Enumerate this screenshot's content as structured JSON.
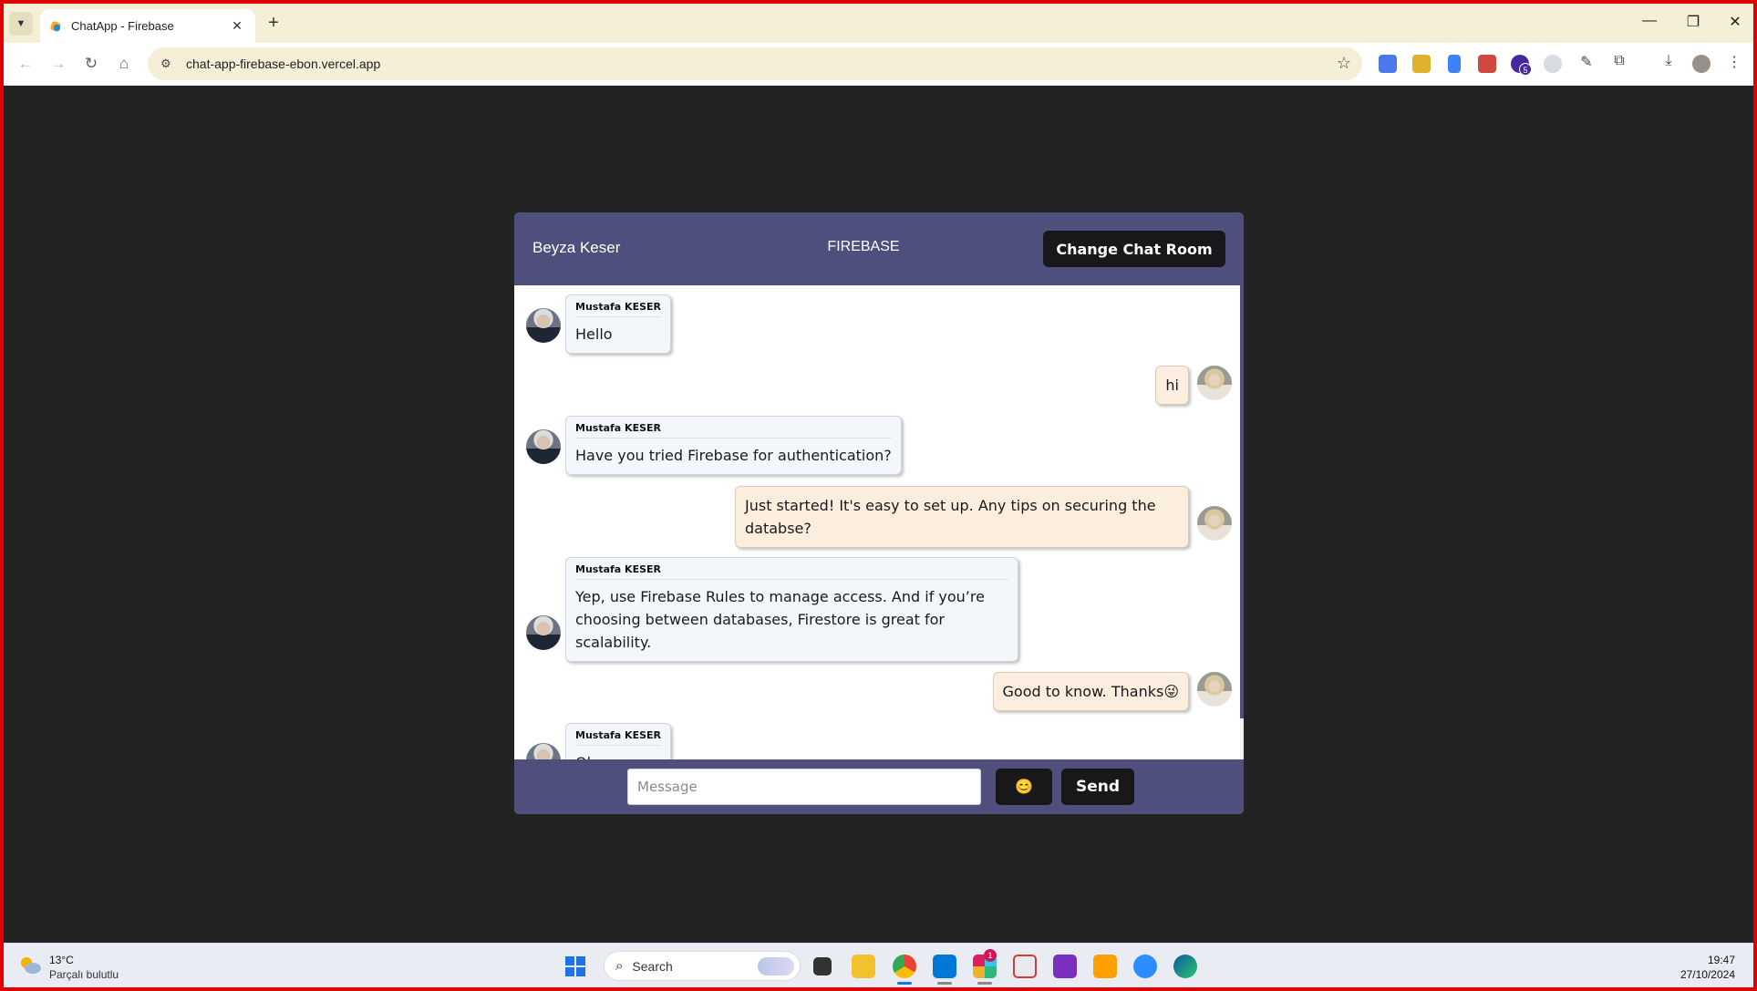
{
  "browser": {
    "tab_title": "ChatApp - Firebase",
    "url": "chat-app-firebase-ebon.vercel.app",
    "extension_badge": "5"
  },
  "chat": {
    "user_name": "Beyza Keser",
    "room_name": "FIREBASE",
    "change_room_label": "Change Chat Room",
    "messages": [
      {
        "sender": "Mustafa KESER",
        "text": "Hello",
        "direction": "incoming"
      },
      {
        "sender": "",
        "text": "hi",
        "direction": "outgoing"
      },
      {
        "sender": "Mustafa KESER",
        "text": "Have you tried Firebase for authentication?",
        "direction": "incoming"
      },
      {
        "sender": "",
        "text": "Just started! It's easy to set up. Any tips on securing the databse?",
        "direction": "outgoing"
      },
      {
        "sender": "Mustafa KESER",
        "text": "Yep, use Firebase Rules to manage access. And if you’re choosing between databases, Firestore is great for scalability.",
        "direction": "incoming"
      },
      {
        "sender": "",
        "text": "Good to know. Thanks😜",
        "direction": "outgoing"
      },
      {
        "sender": "Mustafa KESER",
        "text": "Ok",
        "direction": "incoming"
      }
    ],
    "composer": {
      "placeholder": "Message",
      "emoji_label": "😊",
      "send_label": "Send"
    }
  },
  "taskbar": {
    "weather_temp": "13°C",
    "weather_desc": "Parçalı bulutlu",
    "search_label": "Search",
    "slack_badge": "1",
    "time": "19:47",
    "date": "27/10/2024"
  },
  "colors": {
    "accent": "#4f4f7e",
    "button_dark": "#18181b",
    "incoming_bubble": "#f3f6fb",
    "outgoing_bubble": "#fbeede",
    "page_bg": "#232323"
  }
}
